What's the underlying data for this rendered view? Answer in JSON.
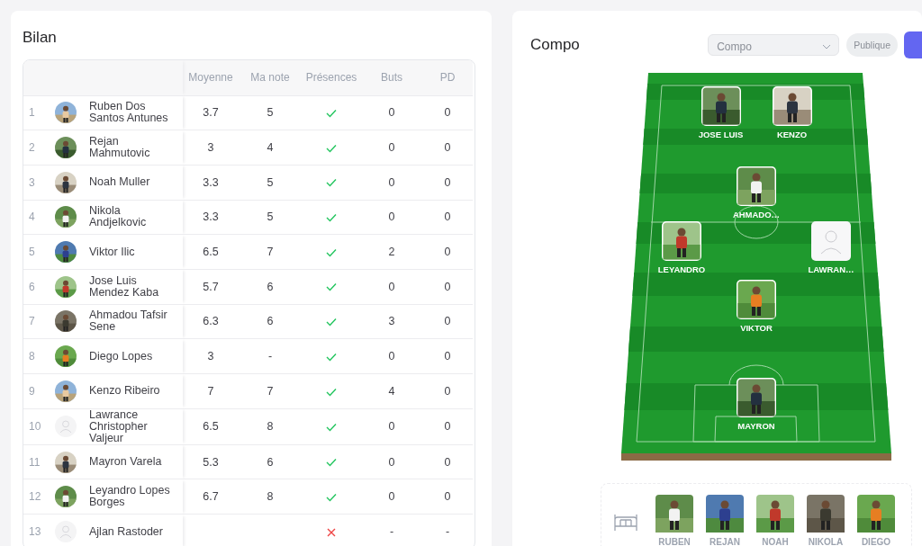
{
  "bilan": {
    "title": "Bilan",
    "columns": [
      "Moyenne",
      "Ma note",
      "Présences",
      "Buts",
      "PD"
    ],
    "rows": [
      {
        "rank": "1",
        "name": "Ruben Dos Santos Antunes",
        "has_photo": true,
        "average": "3.7",
        "my_rating": "5",
        "present": true,
        "goals": "0",
        "pd": "0"
      },
      {
        "rank": "2",
        "name": "Rejan Mahmutovic",
        "has_photo": true,
        "average": "3",
        "my_rating": "4",
        "present": true,
        "goals": "0",
        "pd": "0"
      },
      {
        "rank": "3",
        "name": "Noah Muller",
        "has_photo": true,
        "average": "3.3",
        "my_rating": "5",
        "present": true,
        "goals": "0",
        "pd": "0"
      },
      {
        "rank": "4",
        "name": "Nikola Andjelkovic",
        "has_photo": true,
        "average": "3.3",
        "my_rating": "5",
        "present": true,
        "goals": "0",
        "pd": "0"
      },
      {
        "rank": "5",
        "name": "Viktor Ilic",
        "has_photo": true,
        "average": "6.5",
        "my_rating": "7",
        "present": true,
        "goals": "2",
        "pd": "0"
      },
      {
        "rank": "6",
        "name": "Jose Luis Mendez Kaba",
        "has_photo": true,
        "average": "5.7",
        "my_rating": "6",
        "present": true,
        "goals": "0",
        "pd": "0"
      },
      {
        "rank": "7",
        "name": "Ahmadou Tafsir Sene",
        "has_photo": true,
        "average": "6.3",
        "my_rating": "6",
        "present": true,
        "goals": "3",
        "pd": "0"
      },
      {
        "rank": "8",
        "name": "Diego Lopes",
        "has_photo": true,
        "average": "3",
        "my_rating": "-",
        "present": true,
        "goals": "0",
        "pd": "0"
      },
      {
        "rank": "9",
        "name": "Kenzo Ribeiro",
        "has_photo": true,
        "average": "7",
        "my_rating": "7",
        "present": true,
        "goals": "4",
        "pd": "0"
      },
      {
        "rank": "10",
        "name": "Lawrance Christopher Valjeur",
        "has_photo": false,
        "average": "6.5",
        "my_rating": "8",
        "present": true,
        "goals": "0",
        "pd": "0"
      },
      {
        "rank": "11",
        "name": "Mayron Varela",
        "has_photo": true,
        "average": "5.3",
        "my_rating": "6",
        "present": true,
        "goals": "0",
        "pd": "0"
      },
      {
        "rank": "12",
        "name": "Leyandro Lopes Borges",
        "has_photo": true,
        "average": "6.7",
        "my_rating": "8",
        "present": true,
        "goals": "0",
        "pd": "0"
      },
      {
        "rank": "13",
        "name": "Ajlan Rastoder",
        "has_photo": false,
        "present": false,
        "goals": "-",
        "pd": "-"
      }
    ]
  },
  "compo": {
    "title": "Compo",
    "select": {
      "value": "Compo"
    },
    "visibility": "Publique",
    "pitch_lines": [
      [
        {
          "name": "JOSE LUIS",
          "has_photo": true
        },
        {
          "name": "KENZO",
          "has_photo": true
        }
      ],
      [
        {
          "name": "AHMADO…",
          "has_photo": true
        }
      ],
      [
        {
          "name": "LEYANDRO",
          "has_photo": true
        },
        {
          "name": "LAWRAN…",
          "has_photo": false
        }
      ],
      [
        {
          "name": "VIKTOR",
          "has_photo": true
        }
      ],
      [
        {
          "name": "MAYRON",
          "has_photo": true
        }
      ]
    ],
    "bench": [
      {
        "name": "RUBEN"
      },
      {
        "name": "REJAN"
      },
      {
        "name": "NOAH"
      },
      {
        "name": "NIKOLA"
      },
      {
        "name": "DIEGO"
      }
    ]
  }
}
